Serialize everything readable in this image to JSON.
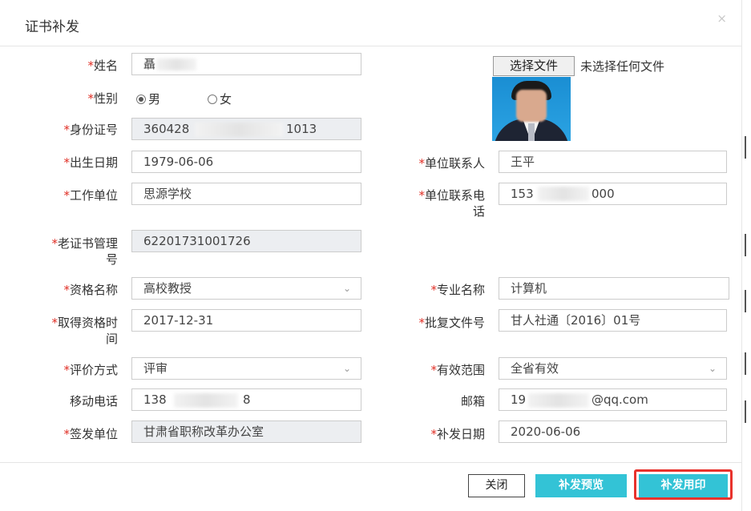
{
  "dialog": {
    "title": "证书补发",
    "close_glyph": "×"
  },
  "required_mark": "*",
  "fields": {
    "name": {
      "label": "姓名",
      "value": "聶"
    },
    "gender": {
      "label": "性别",
      "options": [
        "男",
        "女"
      ],
      "selected": "男"
    },
    "id_number": {
      "label": "身份证号",
      "value_start": "360428",
      "value_end": "1013"
    },
    "birth_date": {
      "label": "出生日期",
      "value": "1979-06-06"
    },
    "work_unit": {
      "label": "工作单位",
      "value": "思源学校"
    },
    "old_cert_no": {
      "label_line1": "老证书管理",
      "label_line2": "号",
      "value": "62201731001726"
    },
    "qualification": {
      "label": "资格名称",
      "value": "高校教授"
    },
    "qual_date": {
      "label_line1": "取得资格时",
      "label_line2": "间",
      "value": "2017-12-31"
    },
    "eval_method": {
      "label": "评价方式",
      "value": "评审"
    },
    "mobile": {
      "label": "移动电话",
      "value_start": "138",
      "value_end": "8"
    },
    "issuer": {
      "label": "签发单位",
      "value": "甘肃省职称改革办公室"
    },
    "contact_person": {
      "label": "单位联系人",
      "value": "王平"
    },
    "contact_phone": {
      "label_line1": "单位联系电",
      "label_line2": "话",
      "value_start": "153",
      "value_end": "000"
    },
    "major": {
      "label": "专业名称",
      "value": "计算机"
    },
    "approval_doc": {
      "label": "批复文件号",
      "value": "甘人社通〔2016〕01号"
    },
    "valid_scope": {
      "label": "有效范围",
      "value": "全省有效"
    },
    "email": {
      "label": "邮箱",
      "value_start": "19",
      "value_end": "@qq.com"
    },
    "reissue_date": {
      "label": "补发日期",
      "value": "2020-06-06"
    }
  },
  "upload": {
    "button": "选择文件",
    "status": "未选择任何文件"
  },
  "footer": {
    "close": "关闭",
    "preview": "补发预览",
    "print": "补发用印"
  },
  "colors": {
    "required": "#e02e24",
    "primary_button": "#33c3d6",
    "highlight_border": "#e8322c",
    "readonly_bg": "#eceef1"
  }
}
